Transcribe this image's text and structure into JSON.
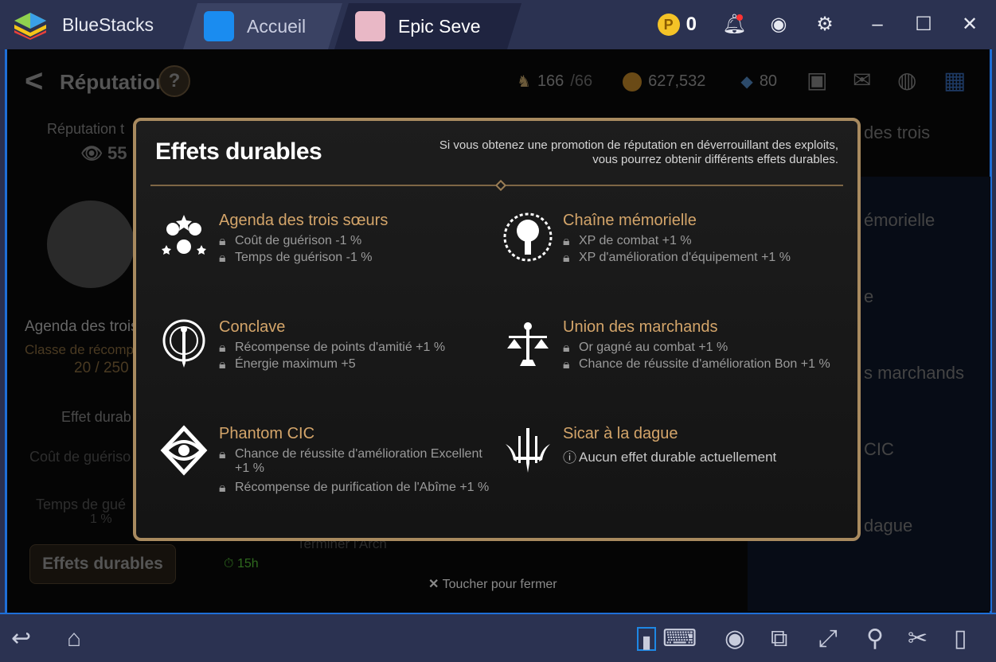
{
  "titlebar": {
    "app_name": "BlueStacks",
    "tabs": [
      {
        "label": "Accueil"
      },
      {
        "label": "Epic Seve"
      }
    ],
    "coins": "0"
  },
  "game": {
    "header": {
      "title": "Réputation",
      "help": "?",
      "stamina": "166",
      "stamina_max": "/66",
      "gold": "627,532",
      "crystals": "80"
    },
    "left": {
      "rep_label": "Réputation t",
      "rep_value": "55",
      "faction": "Agenda des trois",
      "reward_class": "Classe de récomp",
      "progress": "20 / 250",
      "effect_heading": "Effet durab",
      "effect1": "Coût de guériso",
      "effect2": "Temps de gué",
      "effect2_val": "1 %",
      "button": "Effets durables",
      "timer": "15h",
      "mission": "Terminer l'Arch"
    },
    "right": {
      "items": [
        "des trois",
        "émorielle",
        "e",
        "s marchands",
        "CIC",
        "dague"
      ]
    }
  },
  "modal": {
    "title": "Effets durables",
    "description": "Si vous obtenez une promotion de réputation en déverrouillant des exploits, vous pourrez obtenir différents effets durables.",
    "factions": [
      {
        "name": "Agenda des trois sœurs",
        "effects": [
          "Coût de guérison -1 %",
          "Temps de guérison -1 %"
        ]
      },
      {
        "name": "Chaîne mémorielle",
        "effects": [
          "XP de combat +1 %",
          "XP d'amélioration d'équipement +1 %"
        ]
      },
      {
        "name": "Conclave",
        "effects": [
          "Récompense de points d'amitié +1 %",
          "Énergie maximum +5"
        ]
      },
      {
        "name": "Union des marchands",
        "effects": [
          "Or gagné au combat +1 %",
          "Chance de réussite d'amélioration Bon +1 %"
        ]
      },
      {
        "name": "Phantom CIC",
        "effects": [
          "Chance de réussite d'amélioration Excellent +1 %",
          "Récompense de purification de l'Abîme +1 %"
        ]
      },
      {
        "name": "Sicar à la dague",
        "info": "Aucun effet durable actuellement"
      }
    ],
    "close_hint": "Toucher pour fermer"
  },
  "colors": {
    "accent_gold": "#d4a56a",
    "frame": "#a88a5f",
    "bluestacks_blue": "#1e6fd8"
  }
}
